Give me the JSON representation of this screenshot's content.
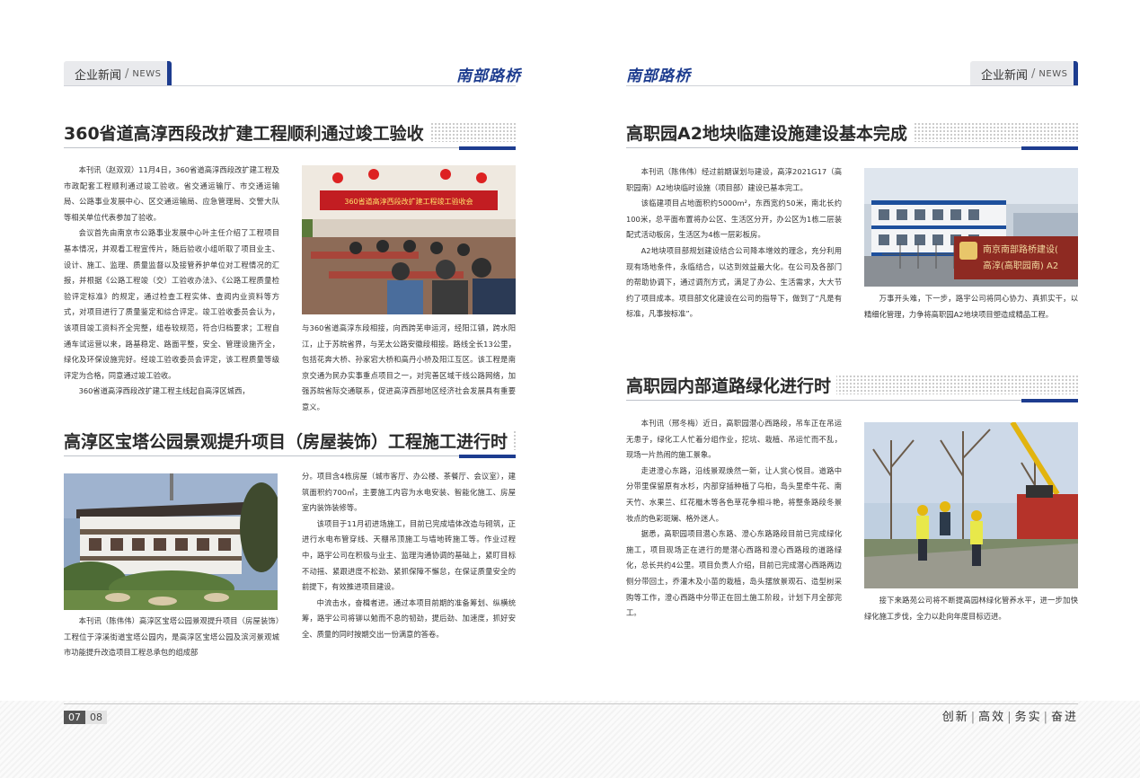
{
  "header": {
    "left_tab_cn": "企业新闻",
    "left_tab_slash": "/",
    "left_tab_en": "NEWS",
    "left_logo": "南部路桥",
    "right_logo": "南部路桥",
    "right_tab_cn": "企业新闻",
    "right_tab_slash": "/",
    "right_tab_en": "NEWS"
  },
  "articles": {
    "a1": {
      "title": "360省道高淳西段改扩建工程顺利通过竣工验收",
      "col1": [
        "本刊讯（赵双双）11月4日，360省道高淳西段改扩建工程及市政配套工程顺利通过竣工验收。省交通运输厅、市交通运输局、公路事业发展中心、区交通运输局、应急管理局、交警大队等相关单位代表参加了验收。",
        "会议首先由南京市公路事业发展中心叶主任介绍了工程项目基本情况，并观看工程宣传片，随后验收小组听取了项目业主、设计、施工、监理、质量监督以及接管养护单位对工程情况的汇报，并根据《公路工程竣（交）工验收办法》、《公路工程质量检验评定标准》的规定，通过检查工程实体、查阅内业资料等方式，对项目进行了质量鉴定和综合评定。竣工验收委员会认为，该项目竣工资料齐全完整，组卷较规范，符合归档要求；工程自通车试运营以来，路基稳定、路面平整，安全、管理设施齐全，绿化及环保设施完好。经竣工验收委员会评定，该工程质量等级评定为合格，同意通过竣工验收。",
        "360省道高淳西段改扩建工程主线起自高淳区城西，"
      ],
      "col2": "与360省道高淳东段相接，向西跨芜申运河，经阳江镇，跨水阳江，止于苏皖省界，与芜太公路安徽段相接。路线全长13公里，包括花奔大桥、孙家宕大桥和高丹小桥及阳江互区。该工程是南京交通为民办实事重点项目之一，对完善区域干线公路网络，加强苏皖省际交通联系，促进高淳西部地区经济社会发展具有重要意义。",
      "photo_banner": "360省道高淳西段改扩建工程竣工验收会"
    },
    "a2": {
      "title": "高淳区宝塔公园景观提升项目（房屋装饰）工程施工进行时",
      "col1": "本刊讯（陈伟伟）高淳区宝塔公园景观提升项目（房屋装饰）工程位于淳溪街道宝塔公园内，是高淳区宝塔公园及滨河景观城市功能提升改造项目工程总承包的组成部",
      "col2": [
        "分。项目含4栋房屋（城市客厅、办公楼、茶餐厅、会议室），建筑面积约700㎡，主要施工内容为水电安装、智能化施工、房屋室内装饰装修等。",
        "该项目于11月初进场施工，目前已完成墙体改造与砌筑，正进行水电布管穿线、天棚吊顶施工与墙地砖施工等。作业过程中，路宇公司在积极与业主、监理沟通协调的基础上，紧盯目标不动摇、紧跟进度不松劲、紧抓保障不懈怠，在保证质量安全的前提下，有效推进项目建设。",
        "中流击水，奋楫者进。通过本项目前期的准备筹划、纵横统筹，路宇公司将铆以勉而不息的韧劲，提后劲、加速度，抓好安全、质量的同时按期交出一份满意的答卷。"
      ]
    },
    "a3": {
      "title": "高职园A2地块临建设施建设基本完成",
      "col1": [
        "本刊讯（陈伟伟）经过前期谋划与建设，高淳2021G17（高职园南）A2地块临时设施（项目部）建设已基本完工。",
        "该临建项目占地面积约5000m²，东西宽约50米，南北长约100米，总平面布置将办公区、生活区分开，办公区为1栋二层装配式活动板房，生活区为4栋一层彩板房。",
        "A2地块项目部规划建设结合公司降本增效的理念，充分利用现有场地条件，永临结合，以达到效益最大化。在公司及各部门的帮助协调下，通过调剂方式，满足了办公、生活需求，大大节约了项目成本。项目部文化建设在公司的指导下，做到了“凡是有标准，凡事按标准”。"
      ],
      "col2": "万事开头难，下一步，路宇公司将同心协力、真抓实干，以精细化管理，力争将高职园A2地块项目塑造成精品工程。",
      "sign_line1": "南京南部路桥建设(",
      "sign_line2": "高淳(高职园南) A2"
    },
    "a4": {
      "title": "高职园内部道路绿化进行时",
      "col1": [
        "本刊讯（邢冬梅）近日，高职园潜心西路段，吊车正在吊运无患子，绿化工人忙着分组作业，挖坑、栽植、吊运忙而不乱，现场一片热闹的施工景象。",
        "走进澄心东路，沿线景观焕然一新，让人赏心悦目。道路中分带里保留原有水杉，内部穿插种植了乌桕，岛头里牵牛花、南天竹、水果兰、红花檵木等各色草花争相斗艳，将整条路段冬景妆点的色彩斑斓、格外迷人。",
        "据悉，高职园项目潜心东路、澄心东路路段目前已完成绿化施工，项目现场正在进行的是潜心西路和澄心西路段的道路绿化，总长共约4公里。项目负责人介绍，目前已完成潜心西路两边侧分带回土，乔灌木及小苗的栽植，岛头摆放景观石、造型树采购等工作，澄心西路中分带正在回土施工阶段，计划下月全部完工。"
      ],
      "col2": "接下来路苑公司将不断提高园林绿化管养水平，进一步加快绿化施工步伐，全力以赴向年度目标迈进。"
    }
  },
  "footer": {
    "page_left": "07",
    "page_right": "08",
    "slogan": [
      "创新",
      "高效",
      "务实",
      "奋进"
    ],
    "slogan_sep": "|"
  },
  "colors": {
    "accent": "#1d3c8f",
    "text": "#333333",
    "tab_bg": "#e9eaed"
  }
}
